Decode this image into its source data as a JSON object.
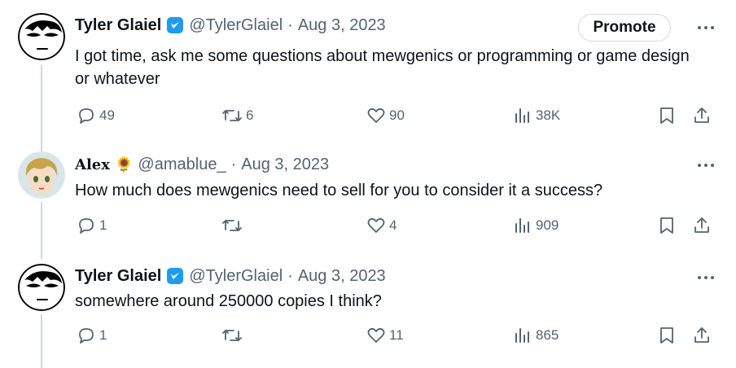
{
  "tweets": [
    {
      "name": "Tyler Glaiel",
      "handle": "@TylerGlaiel",
      "separator": "·",
      "date": "Aug 3, 2023",
      "text": "I got time, ask me some questions about mewgenics or programming or game design or whatever",
      "promote_label": "Promote",
      "replies": "49",
      "reposts": "6",
      "likes": "90",
      "views": "38K",
      "avatar_icon": "tyler-avatar-icon",
      "verified_icon": "verified-badge-icon"
    },
    {
      "name": "Alex",
      "name_emoji": "🌻",
      "handle": "@amablue_",
      "separator": "·",
      "date": "Aug 3, 2023",
      "text": "How much does mewgenics need to sell for you to consider it a success?",
      "replies": "1",
      "reposts": "",
      "likes": "4",
      "views": "909",
      "avatar_icon": "alex-avatar-icon"
    },
    {
      "name": "Tyler Glaiel",
      "handle": "@TylerGlaiel",
      "separator": "·",
      "date": "Aug 3, 2023",
      "text": "somewhere around 250000 copies I think?",
      "replies": "1",
      "reposts": "",
      "likes": "11",
      "views": "865",
      "avatar_icon": "tyler-avatar-icon",
      "verified_icon": "verified-badge-icon"
    }
  ],
  "colors": {
    "text": "#0f1419",
    "secondary": "#536471",
    "verified": "#1d9bf0",
    "thread_line": "#cfd9de"
  },
  "icons": {
    "reply": "reply-icon",
    "repost": "repost-icon",
    "like": "heart-icon",
    "views": "views-chart-icon",
    "bookmark": "bookmark-icon",
    "share": "share-icon",
    "more": "more-dots-icon"
  }
}
